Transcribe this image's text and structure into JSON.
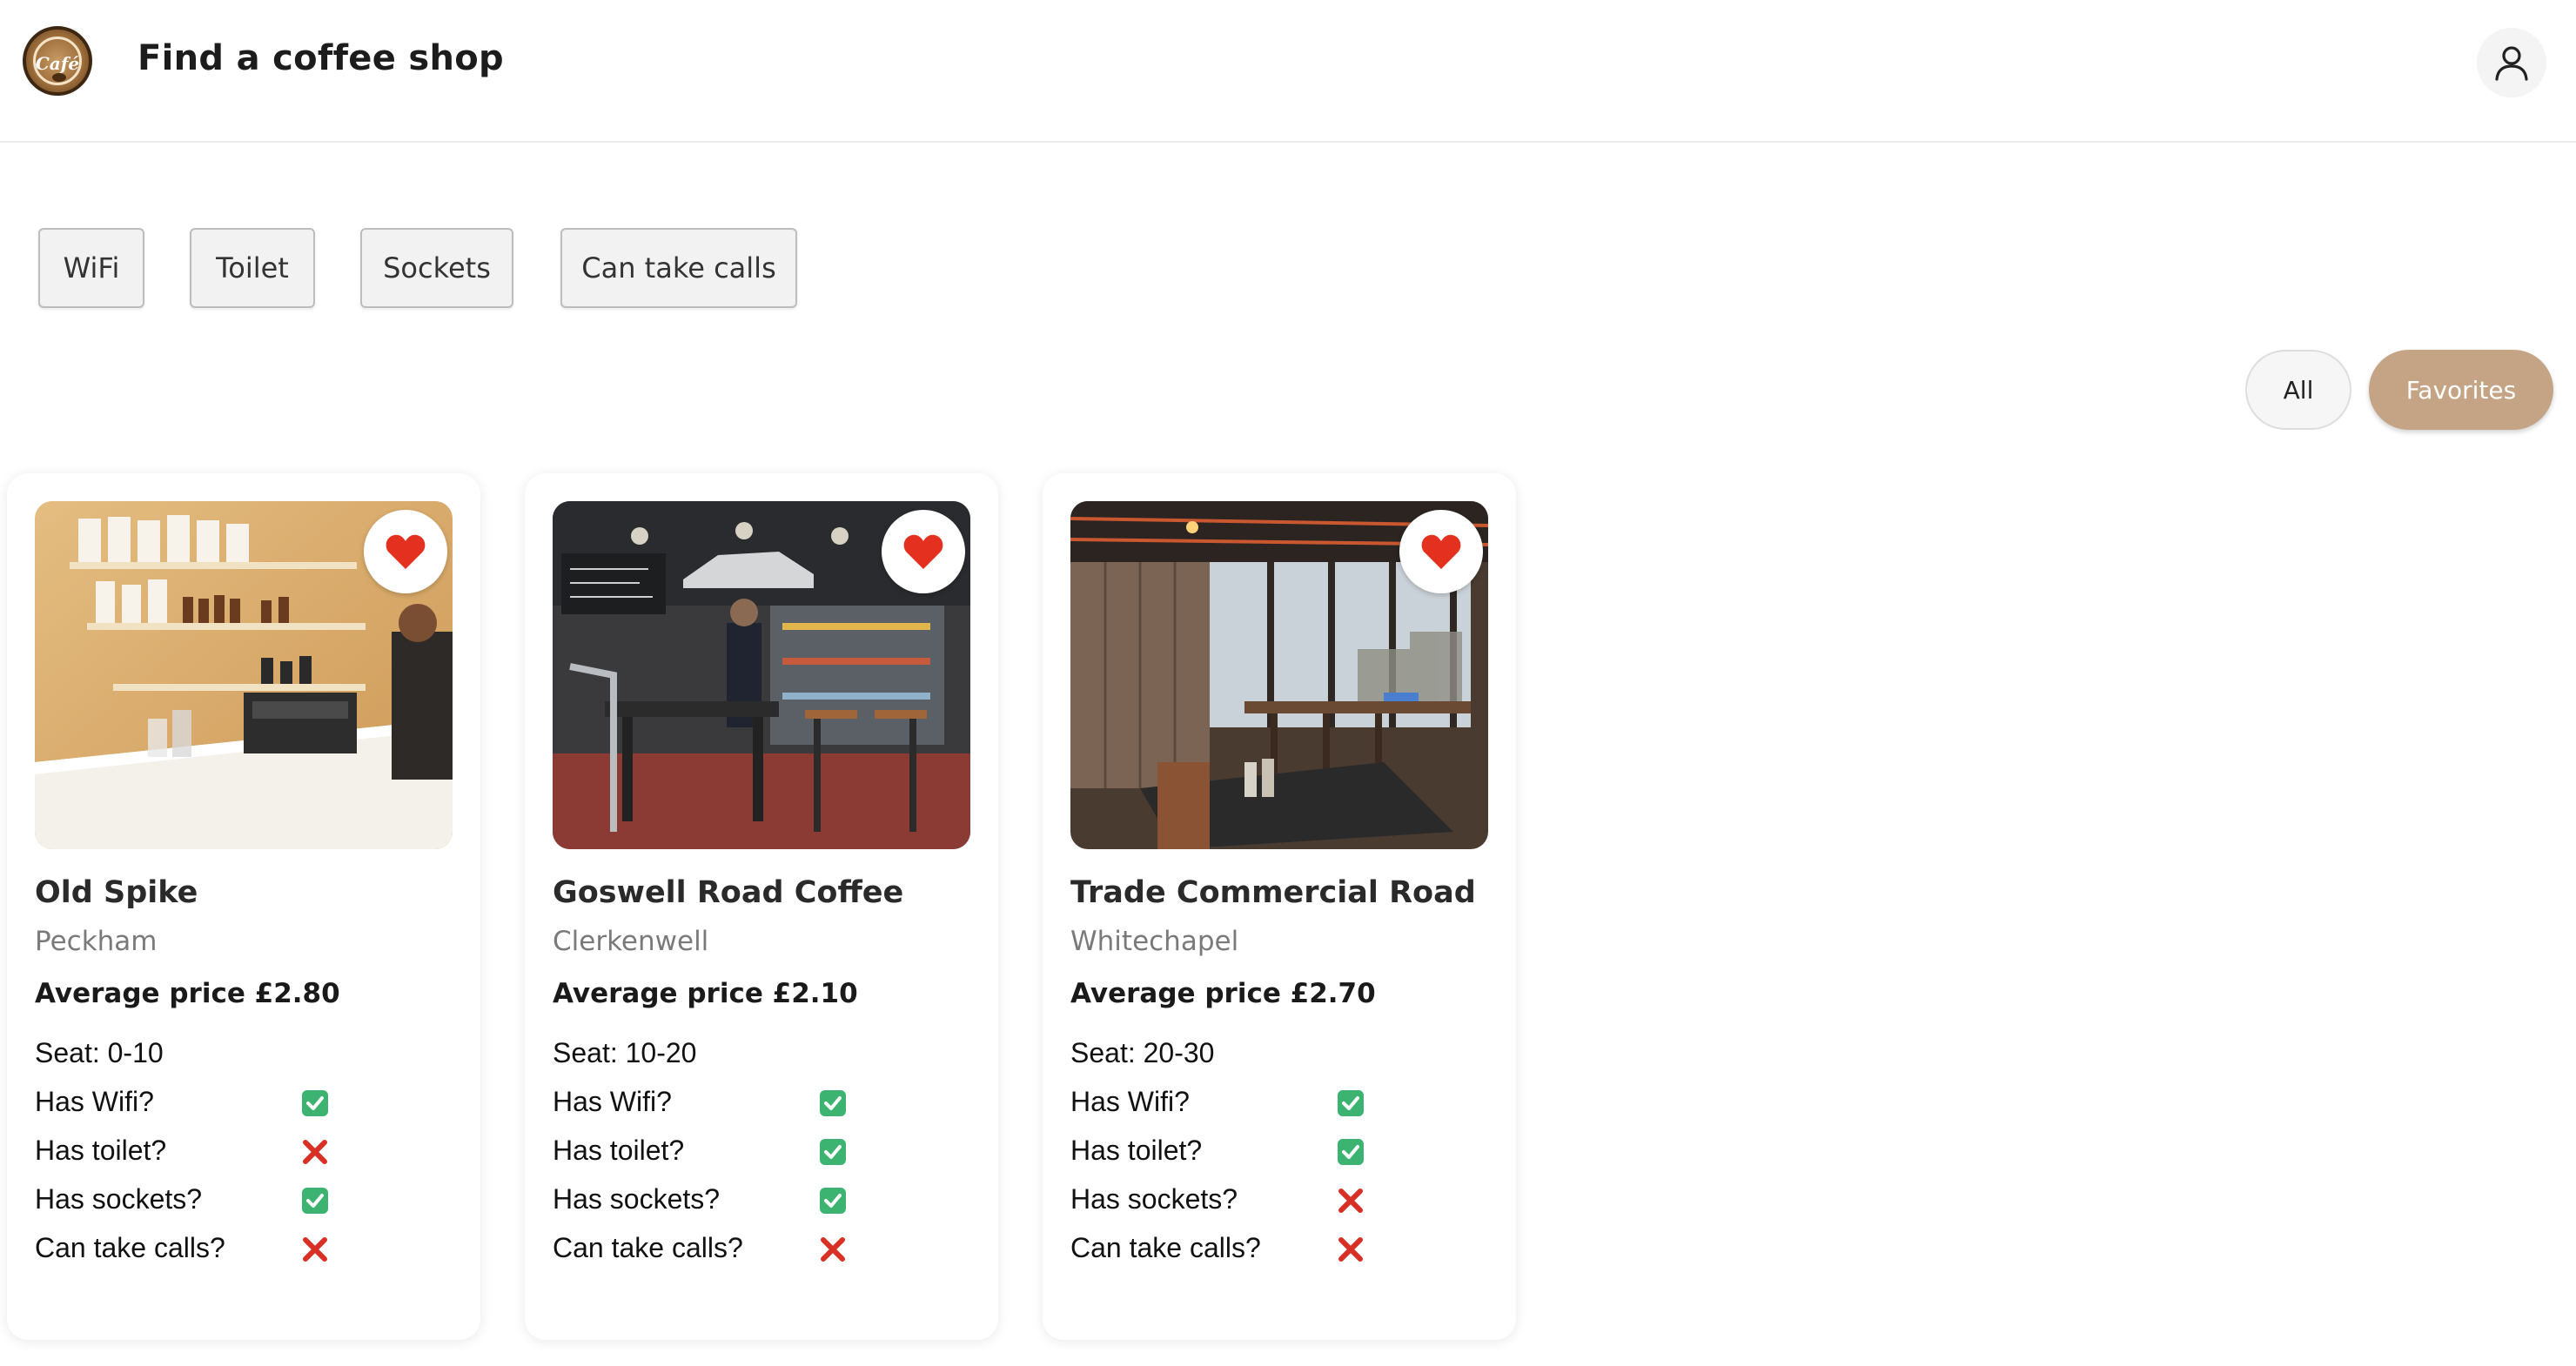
{
  "header": {
    "logo_text": "Café",
    "title": "Find a coffee shop",
    "profile_icon": "user-icon"
  },
  "filters": [
    {
      "label": "WiFi"
    },
    {
      "label": "Toilet"
    },
    {
      "label": "Sockets"
    },
    {
      "label": "Can take calls"
    }
  ],
  "view_toggle": {
    "all_label": "All",
    "favorites_label": "Favorites",
    "selected": "Favorites"
  },
  "colors": {
    "accent": "#c4a484",
    "heart": "#e4311f",
    "check": "#3cb371",
    "cross": "#d93025"
  },
  "feature_labels": {
    "seat_prefix": "Seat:",
    "wifi": "Has Wifi?",
    "toilet": "Has toilet?",
    "sockets": "Has sockets?",
    "calls": "Can take calls?"
  },
  "cards": [
    {
      "name": "Old Spike",
      "area": "Peckham",
      "price": "Average price £2.80",
      "seat": "Seat: 0-10",
      "favorite": true,
      "wifi": true,
      "toilet": false,
      "sockets": true,
      "calls": false
    },
    {
      "name": "Goswell Road Coffee",
      "area": "Clerkenwell",
      "price": "Average price £2.10",
      "seat": "Seat: 10-20",
      "favorite": true,
      "wifi": true,
      "toilet": true,
      "sockets": true,
      "calls": false
    },
    {
      "name": "Trade Commercial Road",
      "area": "Whitechapel",
      "price": "Average price £2.70",
      "seat": "Seat: 20-30",
      "favorite": true,
      "wifi": true,
      "toilet": true,
      "sockets": false,
      "calls": false
    }
  ]
}
